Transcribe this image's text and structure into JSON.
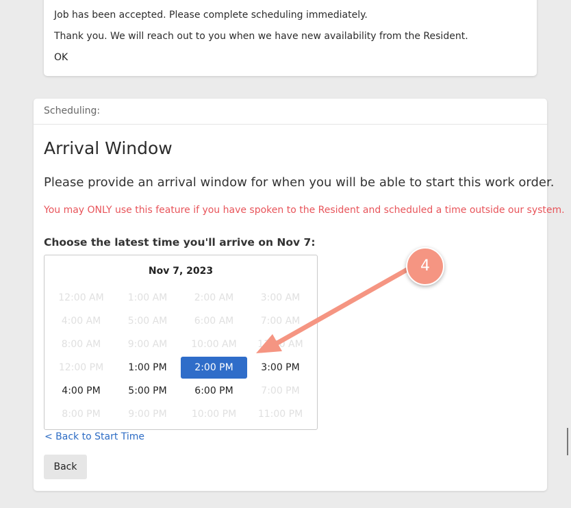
{
  "notice": {
    "line1": "Job has been accepted. Please complete scheduling immediately.",
    "line2": "Thank you. We will reach out to you when we have new availability from the Resident.",
    "ok_label": "OK"
  },
  "scheduling": {
    "header": "Scheduling:",
    "title": "Arrival Window",
    "description": "Please provide an arrival window for when you will be able to start this work order.",
    "warning": "You may ONLY use this feature if you have spoken to the Resident and scheduled a time outside our system.",
    "choose_label": "Choose the latest time you'll arrive on Nov 7:",
    "picker_date": "Nov 7, 2023",
    "slots": [
      {
        "label": "12:00 AM",
        "state": "disabled"
      },
      {
        "label": "1:00 AM",
        "state": "disabled"
      },
      {
        "label": "2:00 AM",
        "state": "disabled"
      },
      {
        "label": "3:00 AM",
        "state": "disabled"
      },
      {
        "label": "4:00 AM",
        "state": "disabled"
      },
      {
        "label": "5:00 AM",
        "state": "disabled"
      },
      {
        "label": "6:00 AM",
        "state": "disabled"
      },
      {
        "label": "7:00 AM",
        "state": "disabled"
      },
      {
        "label": "8:00 AM",
        "state": "disabled"
      },
      {
        "label": "9:00 AM",
        "state": "disabled"
      },
      {
        "label": "10:00 AM",
        "state": "disabled"
      },
      {
        "label": "11:00 AM",
        "state": "disabled"
      },
      {
        "label": "12:00 PM",
        "state": "disabled"
      },
      {
        "label": "1:00 PM",
        "state": "enabled"
      },
      {
        "label": "2:00 PM",
        "state": "selected"
      },
      {
        "label": "3:00 PM",
        "state": "enabled"
      },
      {
        "label": "4:00 PM",
        "state": "enabled"
      },
      {
        "label": "5:00 PM",
        "state": "enabled"
      },
      {
        "label": "6:00 PM",
        "state": "enabled"
      },
      {
        "label": "7:00 PM",
        "state": "disabled"
      },
      {
        "label": "8:00 PM",
        "state": "disabled"
      },
      {
        "label": "9:00 PM",
        "state": "disabled"
      },
      {
        "label": "10:00 PM",
        "state": "disabled"
      },
      {
        "label": "11:00 PM",
        "state": "disabled"
      }
    ],
    "back_link": "< Back to Start Time",
    "back_button": "Back"
  },
  "annotation": {
    "step_number": "4",
    "color": "#f59582"
  },
  "colors": {
    "accent": "#2f6dc9",
    "warning": "#e8545a",
    "link": "#2d6cc4",
    "page_bg": "#ebebeb"
  }
}
